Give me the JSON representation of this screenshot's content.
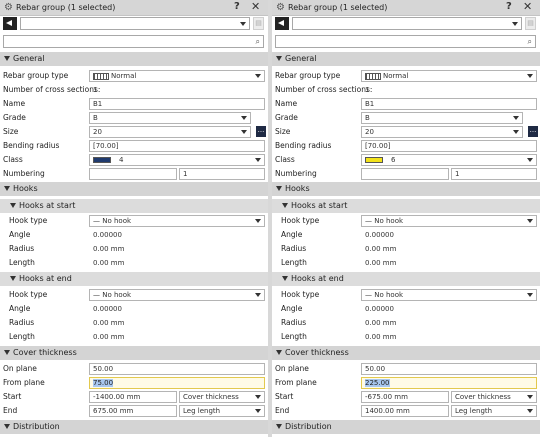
{
  "panels": [
    {
      "title": "Rebar group (1 selected)",
      "help": "?",
      "close": "✕",
      "general": {
        "header": "General",
        "rebar_group_type_label": "Rebar group type",
        "rebar_group_type_value": "Normal",
        "num_cross_sections_label": "Number of cross sections:",
        "num_cross_sections_value": "1",
        "name_label": "Name",
        "name_value": "B1",
        "grade_label": "Grade",
        "grade_value": "B",
        "size_label": "Size",
        "size_value": "20",
        "size_more": "...",
        "bending_radius_label": "Bending radius",
        "bending_radius_value": "[70.00]",
        "class_label": "Class",
        "class_value": "4",
        "class_color": "#1f3a6e",
        "numbering_label": "Numbering",
        "numbering_prefix": "",
        "numbering_start": "1"
      },
      "hooks": {
        "header": "Hooks",
        "start_header": "Hooks at start",
        "start": {
          "hook_type_label": "Hook type",
          "hook_type_value": "— No hook",
          "angle_label": "Angle",
          "angle_value": "0.00000",
          "radius_label": "Radius",
          "radius_value": "0.00 mm",
          "length_label": "Length",
          "length_value": "0.00 mm"
        },
        "end_header": "Hooks at end",
        "end": {
          "hook_type_label": "Hook type",
          "hook_type_value": "— No hook",
          "angle_label": "Angle",
          "angle_value": "0.00000",
          "radius_label": "Radius",
          "radius_value": "0.00 mm",
          "length_label": "Length",
          "length_value": "0.00 mm"
        }
      },
      "cover": {
        "header": "Cover thickness",
        "on_plane_label": "On plane",
        "on_plane_value": "50.00",
        "from_plane_label": "From plane",
        "from_plane_value": "75.00",
        "start_label": "Start",
        "start_value": "-1400.00 mm",
        "start_mode": "Cover thickness",
        "end_label": "End",
        "end_value": "675.00 mm",
        "end_mode": "Leg length"
      },
      "distribution": {
        "header": "Distribution"
      }
    },
    {
      "title": "Rebar group (1 selected)",
      "help": "?",
      "close": "✕",
      "general": {
        "header": "General",
        "rebar_group_type_label": "Rebar group type",
        "rebar_group_type_value": "Normal",
        "num_cross_sections_label": "Number of cross sections:",
        "num_cross_sections_value": "1",
        "name_label": "Name",
        "name_value": "B1",
        "grade_label": "Grade",
        "grade_value": "B",
        "size_label": "Size",
        "size_value": "20",
        "size_more": "...",
        "bending_radius_label": "Bending radius",
        "bending_radius_value": "[70.00]",
        "class_label": "Class",
        "class_value": "6",
        "class_color": "#f2e21a",
        "numbering_label": "Numbering",
        "numbering_prefix": "",
        "numbering_start": "1"
      },
      "hooks": {
        "header": "Hooks",
        "start_header": "Hooks at start",
        "start": {
          "hook_type_label": "Hook type",
          "hook_type_value": "— No hook",
          "angle_label": "Angle",
          "angle_value": "0.00000",
          "radius_label": "Radius",
          "radius_value": "0.00 mm",
          "length_label": "Length",
          "length_value": "0.00 mm"
        },
        "end_header": "Hooks at end",
        "end": {
          "hook_type_label": "Hook type",
          "hook_type_value": "— No hook",
          "angle_label": "Angle",
          "angle_value": "0.00000",
          "radius_label": "Radius",
          "radius_value": "0.00 mm",
          "length_label": "Length",
          "length_value": "0.00 mm"
        }
      },
      "cover": {
        "header": "Cover thickness",
        "on_plane_label": "On plane",
        "on_plane_value": "50.00",
        "from_plane_label": "From plane",
        "from_plane_value": "225.00",
        "start_label": "Start",
        "start_value": "-675.00 mm",
        "start_mode": "Cover thickness",
        "end_label": "End",
        "end_value": "1400.00 mm",
        "end_mode": "Leg length"
      },
      "distribution": {
        "header": "Distribution"
      }
    }
  ]
}
